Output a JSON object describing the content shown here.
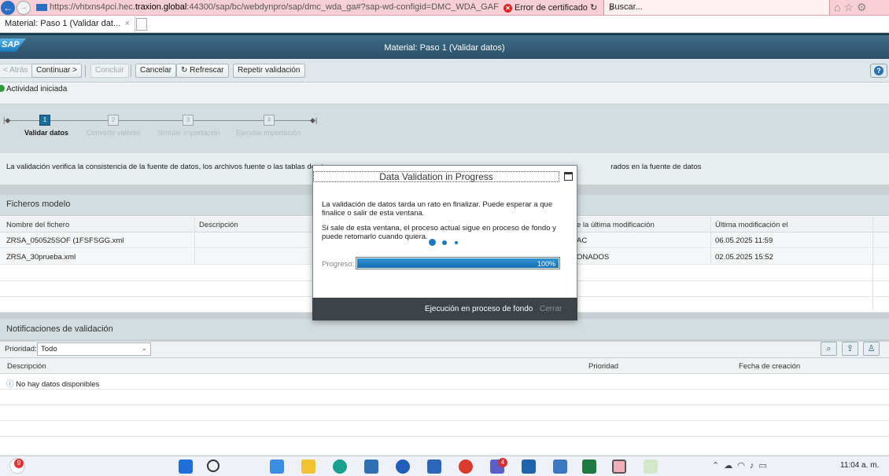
{
  "browser": {
    "url_prefix": "https://vhtxns4pci.hec.",
    "url_host": "traxion.global",
    "url_suffix": ":44300/sap/bc/webdynpro/sap/dmc_wda_ga#?sap-wd-configid=DMC_WDA_GAF",
    "cert_error": "Error de certificado",
    "search_placeholder": "Buscar...",
    "tab_title": "Material: Paso 1  (Validar dat...",
    "tab_close": "×"
  },
  "shell": {
    "logo": "SAP",
    "title": "Material: Paso 1  (Validar datos)"
  },
  "toolbar": {
    "back": "< Atrás",
    "continue": "Continuar >",
    "finish": "Concluir",
    "cancel": "Cancelar",
    "refresh": "Refrescar",
    "repeat": "Repetir validación"
  },
  "message": {
    "text": "Actividad iniciada",
    "status_color": "#2e9a3c"
  },
  "roadmap": {
    "steps": [
      {
        "num": "1",
        "label": "Validar datos",
        "active": true
      },
      {
        "num": "2",
        "label": "Convertir valores",
        "active": false
      },
      {
        "num": "3",
        "label": "Simular importación",
        "active": false
      },
      {
        "num": "4",
        "label": "Ejecutar importación",
        "active": false
      }
    ]
  },
  "description": {
    "text_left": "La validación verifica la consistencia de la fuente de datos, los archivos fuente o las tablas de sta",
    "text_right": "rados en la fuente de datos"
  },
  "files_panel": {
    "title": "Ficheros modelo",
    "columns": [
      "Nombre del fichero",
      "Descripción",
      "e la última modificación",
      "Última modificación el"
    ],
    "rows": [
      {
        "name": "ZRSA_050525SOF (1FSFSGG.xml",
        "description": "",
        "modified_by": "AC",
        "modified_on": "06.05.2025 11:59"
      },
      {
        "name": "ZRSA_30prueba.xml",
        "description": "",
        "modified_by": "ONADOS",
        "modified_on": "02.05.2025 15:52"
      }
    ]
  },
  "notifications_panel": {
    "title": "Notificaciones de validación",
    "priority_label": "Prioridad:",
    "priority_value": "Todo",
    "columns": [
      "Descripción",
      "Prioridad",
      "Fecha de creación"
    ],
    "empty_text": "No hay datos disponibles"
  },
  "modal": {
    "title": "Data Validation in Progress",
    "line1": "La validación de datos tarda un rato en finalizar. Puede esperar a que finalice o salir de esta ventana.",
    "line2": "Si sale de esta ventana, el proceso actual sigue en proceso de fondo y puede retomarlo cuando quiera.",
    "progress_label": "Progreso:",
    "progress_value": "100%",
    "progress_fraction": 1.0,
    "run_background": "Ejecución en proceso de fondo",
    "close": "Cerrar"
  },
  "taskbar": {
    "notification_count": "9",
    "teams_badge": "4",
    "clock": "11:04 a. m."
  }
}
